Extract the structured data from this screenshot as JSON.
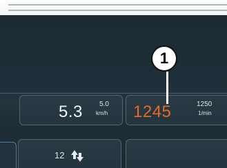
{
  "instrument": {
    "speed": {
      "main": "5.3",
      "target": "5.0",
      "unit": "km/h"
    },
    "rpm": {
      "main": "1245",
      "target": "1250",
      "unit": "1/min"
    },
    "gear": {
      "value": "12"
    }
  },
  "callout": {
    "number": "1"
  },
  "colors": {
    "rpm_accent": "#e06a2b",
    "screen_bg": "#1e2f39"
  }
}
